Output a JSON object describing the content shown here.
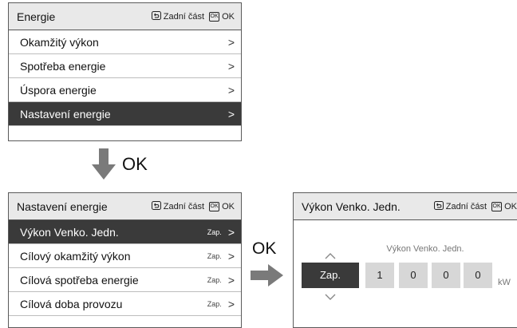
{
  "panel1": {
    "title": "Energie",
    "back_label": "Zadní část",
    "back_icon": "return-icon",
    "ok_icon_text": "OK",
    "ok_label": "OK",
    "items": [
      {
        "label": "Okamžitý výkon",
        "chevron": ">"
      },
      {
        "label": "Spotřeba energie",
        "chevron": ">"
      },
      {
        "label": "Úspora energie",
        "chevron": ">"
      },
      {
        "label": "Nastavení energie",
        "chevron": ">",
        "selected": true
      }
    ]
  },
  "down_ok": "OK",
  "panel2": {
    "title": "Nastavení energie",
    "back_label": "Zadní část",
    "ok_icon_text": "OK",
    "ok_label": "OK",
    "items": [
      {
        "label": "Výkon Venko. Jedn.",
        "status": "Zap.",
        "chevron": ">",
        "selected": true
      },
      {
        "label": "Cílový okamžitý výkon",
        "status": "Zap.",
        "chevron": ">"
      },
      {
        "label": "Cílová spotřeba energie",
        "status": "Zap.",
        "chevron": ">"
      },
      {
        "label": "Cílová doba provozu",
        "status": "Zap.",
        "chevron": ">"
      }
    ]
  },
  "right_ok": "OK",
  "panel3": {
    "title": "Výkon Venko. Jedn.",
    "back_label": "Zadní část",
    "ok_icon_text": "OK",
    "ok_label": "OK",
    "field_label": "Výkon Venko. Jedn.",
    "toggle_value": "Zap.",
    "digits": [
      "1",
      "0",
      "0",
      "0"
    ],
    "unit": "kW"
  }
}
